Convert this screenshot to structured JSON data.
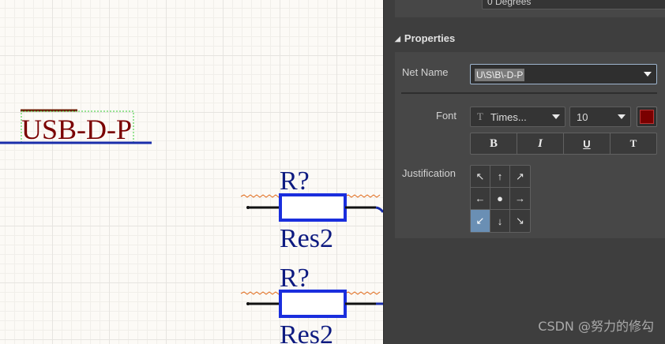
{
  "canvas": {
    "net_label": "USB-D-P",
    "components": [
      {
        "designator": "R?",
        "comment": "Res2"
      },
      {
        "designator": "R?",
        "comment": "Res2"
      }
    ]
  },
  "panel": {
    "previous_field_value": "0 Degrees",
    "section_title": "Properties",
    "net_name_label": "Net Name",
    "net_name_value": "U\\S\\B\\-D-P",
    "font_label": "Font",
    "font_name": "Times...",
    "font_size": "10",
    "font_color": "#7a0000",
    "style_buttons": [
      "B",
      "I",
      "U",
      "T"
    ],
    "justification_label": "Justification",
    "justification_cells": [
      "↖",
      "↑",
      "↗",
      "←",
      "●",
      "→",
      "↙",
      "↓",
      "↘"
    ],
    "justification_selected": "bottom-left"
  },
  "watermark": "CSDN @努力的修勾"
}
